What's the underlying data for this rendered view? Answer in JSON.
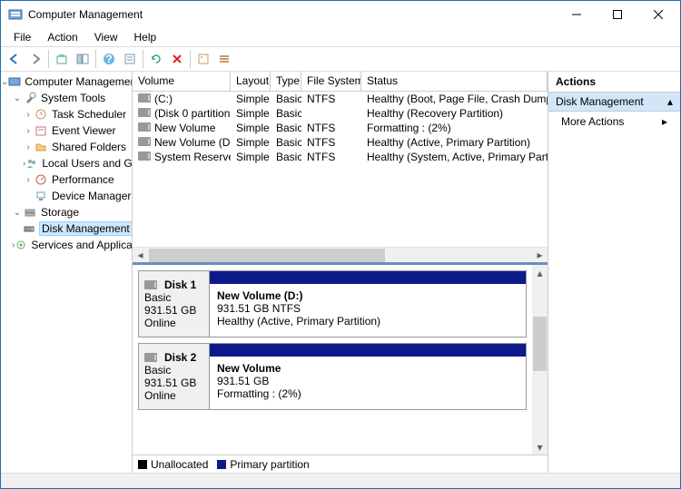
{
  "window": {
    "title": "Computer Management"
  },
  "menu": {
    "items": [
      "File",
      "Action",
      "View",
      "Help"
    ]
  },
  "tree": {
    "root": "Computer Management (L",
    "sys": "System Tools",
    "sys_items": [
      "Task Scheduler",
      "Event Viewer",
      "Shared Folders",
      "Local Users and Gro",
      "Performance",
      "Device Manager"
    ],
    "storage": "Storage",
    "dm": "Disk Management",
    "sa": "Services and Application"
  },
  "vol_headers": {
    "volume": "Volume",
    "layout": "Layout",
    "type": "Type",
    "fs": "File System",
    "status": "Status"
  },
  "volumes": [
    {
      "name": "(C:)",
      "layout": "Simple",
      "type": "Basic",
      "fs": "NTFS",
      "status": "Healthy (Boot, Page File, Crash Dump, Prima"
    },
    {
      "name": "(Disk 0 partition 3)",
      "layout": "Simple",
      "type": "Basic",
      "fs": "",
      "status": "Healthy (Recovery Partition)"
    },
    {
      "name": "New Volume",
      "layout": "Simple",
      "type": "Basic",
      "fs": "NTFS",
      "status": "Formatting : (2%)"
    },
    {
      "name": "New Volume (D:)",
      "layout": "Simple",
      "type": "Basic",
      "fs": "NTFS",
      "status": "Healthy (Active, Primary Partition)"
    },
    {
      "name": "System Reserved",
      "layout": "Simple",
      "type": "Basic",
      "fs": "NTFS",
      "status": "Healthy (System, Active, Primary Partition)"
    }
  ],
  "disks": [
    {
      "name": "Disk 1",
      "type": "Basic",
      "size": "931.51 GB",
      "state": "Online",
      "vol_name": "New Volume  (D:)",
      "vol_line2": "931.51 GB NTFS",
      "vol_line3": "Healthy (Active, Primary Partition)"
    },
    {
      "name": "Disk 2",
      "type": "Basic",
      "size": "931.51 GB",
      "state": "Online",
      "vol_name": "New Volume",
      "vol_line2": "931.51 GB",
      "vol_line3": "Formatting : (2%)"
    }
  ],
  "legend": {
    "unalloc": "Unallocated",
    "primary": "Primary partition"
  },
  "actions": {
    "header": "Actions",
    "dm": "Disk Management",
    "more": "More Actions"
  }
}
